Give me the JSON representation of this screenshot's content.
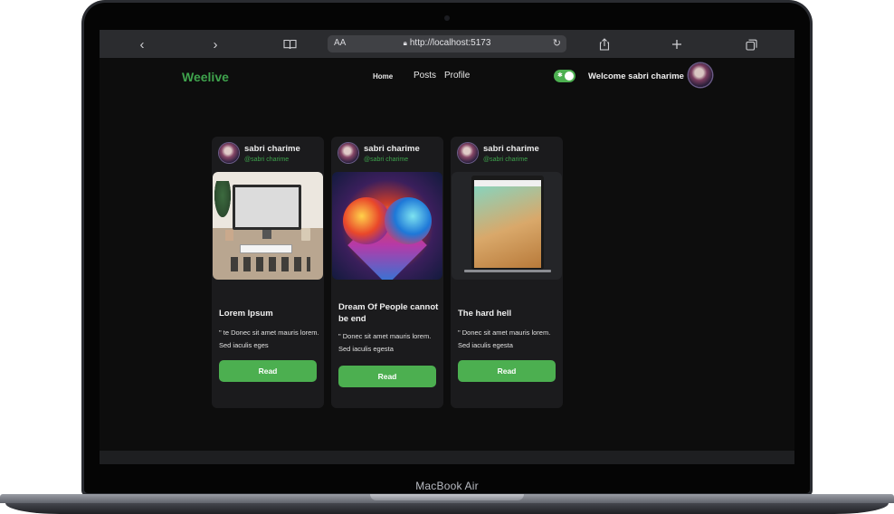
{
  "device": {
    "label": "MacBook Air"
  },
  "browser": {
    "url": "http://localhost:5173",
    "reader_label": "AA",
    "icons": [
      "back-icon",
      "forward-icon",
      "book-icon",
      "lock-icon",
      "reload-icon",
      "share-icon",
      "plus-icon",
      "tabs-icon"
    ]
  },
  "nav": {
    "brand": "Weelive",
    "links": {
      "home": "Home",
      "posts": "Posts",
      "profile": "Profile"
    },
    "welcome": "Welcome sabri charime",
    "toggle_on": true
  },
  "colors": {
    "accent": "#4caf50",
    "brand": "#3fa34d",
    "background": "#0d0d0d",
    "card": "#1b1b1d"
  },
  "posts": [
    {
      "author": "sabri charime",
      "handle": "@sabri charime",
      "title": "Lorem Ipsum",
      "excerpt": "\" te Donec sit amet mauris lorem. Sed iaculis eges",
      "button": "Read"
    },
    {
      "author": "sabri charime",
      "handle": "@sabri charime",
      "title": "Dream Of People cannot be end",
      "excerpt": "\" Donec sit amet mauris lorem. Sed iaculis egesta",
      "button": "Read"
    },
    {
      "author": "sabri charime",
      "handle": "@sabri charime",
      "title": "The hard hell",
      "excerpt": "\" Donec sit amet mauris lorem. Sed iaculis egesta",
      "button": "Read"
    }
  ]
}
